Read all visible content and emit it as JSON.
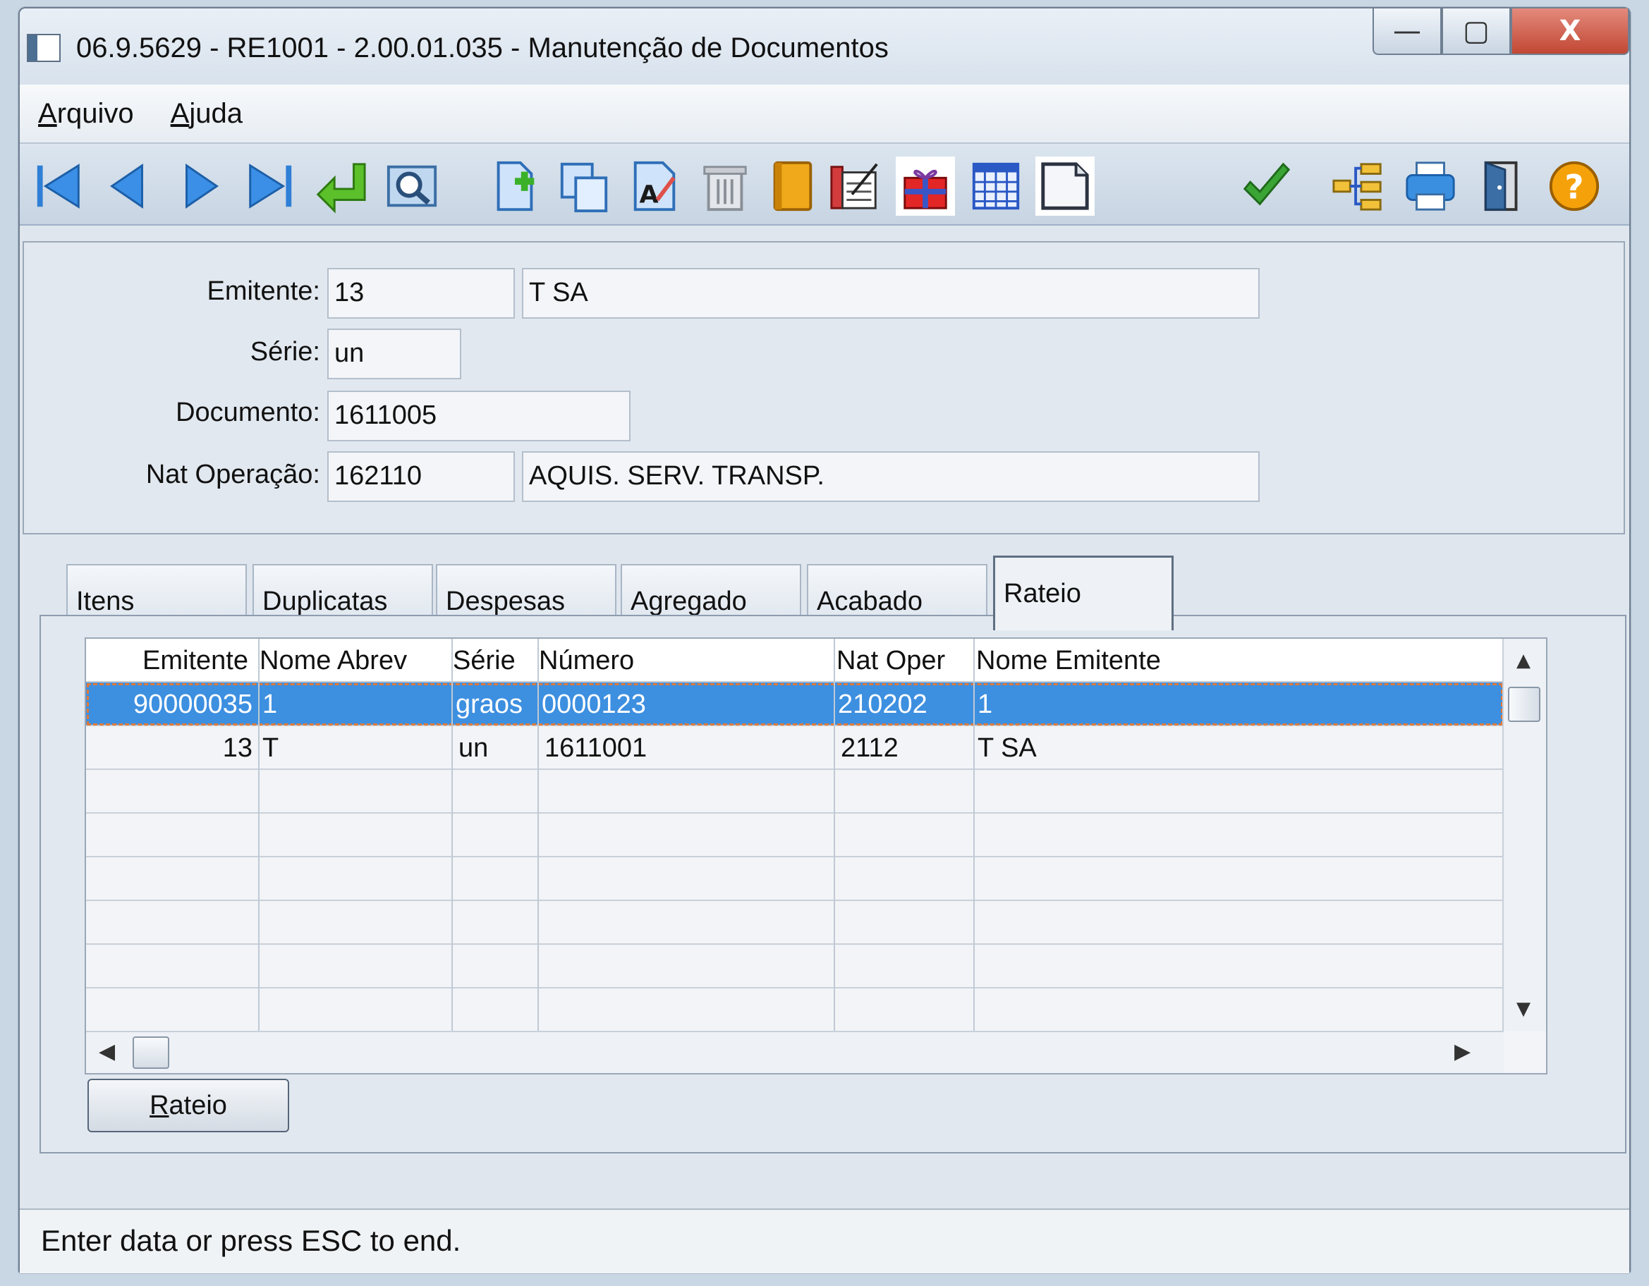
{
  "window": {
    "title": "06.9.5629 - RE1001 - 2.00.01.035 - Manutenção de Documentos",
    "minimize": "—",
    "maximize": "▢",
    "close": "X"
  },
  "menu": {
    "arquivo": {
      "first": "A",
      "rest": "rquivo"
    },
    "ajuda": {
      "first": "A",
      "rest": "juda"
    }
  },
  "toolbar_icons": [
    "first-record-icon",
    "previous-record-icon",
    "next-record-icon",
    "last-record-icon",
    "goto-icon",
    "search-icon",
    "new-icon",
    "copy-icon",
    "edit-icon",
    "delete-icon",
    "book-icon",
    "notes-icon",
    "gift-icon",
    "grid-icon",
    "blank-page-icon",
    "confirm-icon",
    "tree-icon",
    "print-icon",
    "exit-icon",
    "help-icon"
  ],
  "header": {
    "emitente_label": "Emitente:",
    "emitente_code": "13",
    "emitente_name": "T SA",
    "serie_label": "Série:",
    "serie_value": "un",
    "documento_label": "Documento:",
    "documento_value": "1611005",
    "natop_label": "Nat Operação:",
    "natop_code": "162110",
    "natop_desc": "AQUIS. SERV. TRANSP."
  },
  "tabs": [
    "Itens",
    "Duplicatas",
    "Despesas",
    "Agregado",
    "Acabado",
    "Rateio"
  ],
  "active_tab": "Rateio",
  "grid": {
    "columns": [
      "Emitente",
      "Nome Abrev",
      "Série",
      "Número",
      "Nat Oper",
      "Nome Emitente"
    ],
    "rows": [
      [
        "90000035",
        "1",
        "graos",
        "0000123",
        "210202",
        "1"
      ],
      [
        "13",
        "T",
        "un",
        "1611001",
        "2112",
        "T SA"
      ]
    ]
  },
  "rateio_button": {
    "first": "R",
    "rest": "ateio"
  },
  "status": "Enter data or press ESC to end.",
  "colors": {
    "selection": "#3d8fe0",
    "accent_green": "#3aa535",
    "help_orange": "#f5a20a"
  }
}
